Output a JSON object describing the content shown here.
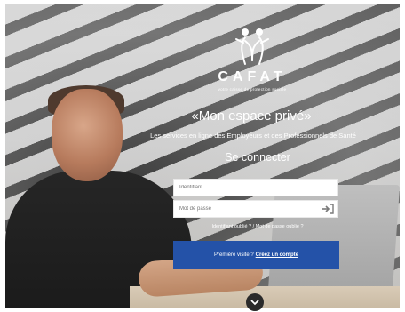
{
  "brand": {
    "name": "CAFAT",
    "tagline": "votre caisse de protection sociale"
  },
  "hero": {
    "heading": "«Mon espace privé»",
    "subheading": "Les services en ligne des Employeurs et des Professionnels de Santé",
    "section_title": "Se connecter"
  },
  "login": {
    "id_placeholder": "Identifiant",
    "password_placeholder": "Mot de passe",
    "submit_icon": "login-arrow-icon",
    "forgot_link": "Identifiant oublié ? / Mot de passe oublié ?"
  },
  "register": {
    "prefix": "Première visite ?",
    "action": "Créez un compte"
  },
  "scroll": {
    "icon": "chevron-down-icon"
  },
  "colors": {
    "primary_button": "#2452a8",
    "text_on_photo": "#ffffff"
  }
}
